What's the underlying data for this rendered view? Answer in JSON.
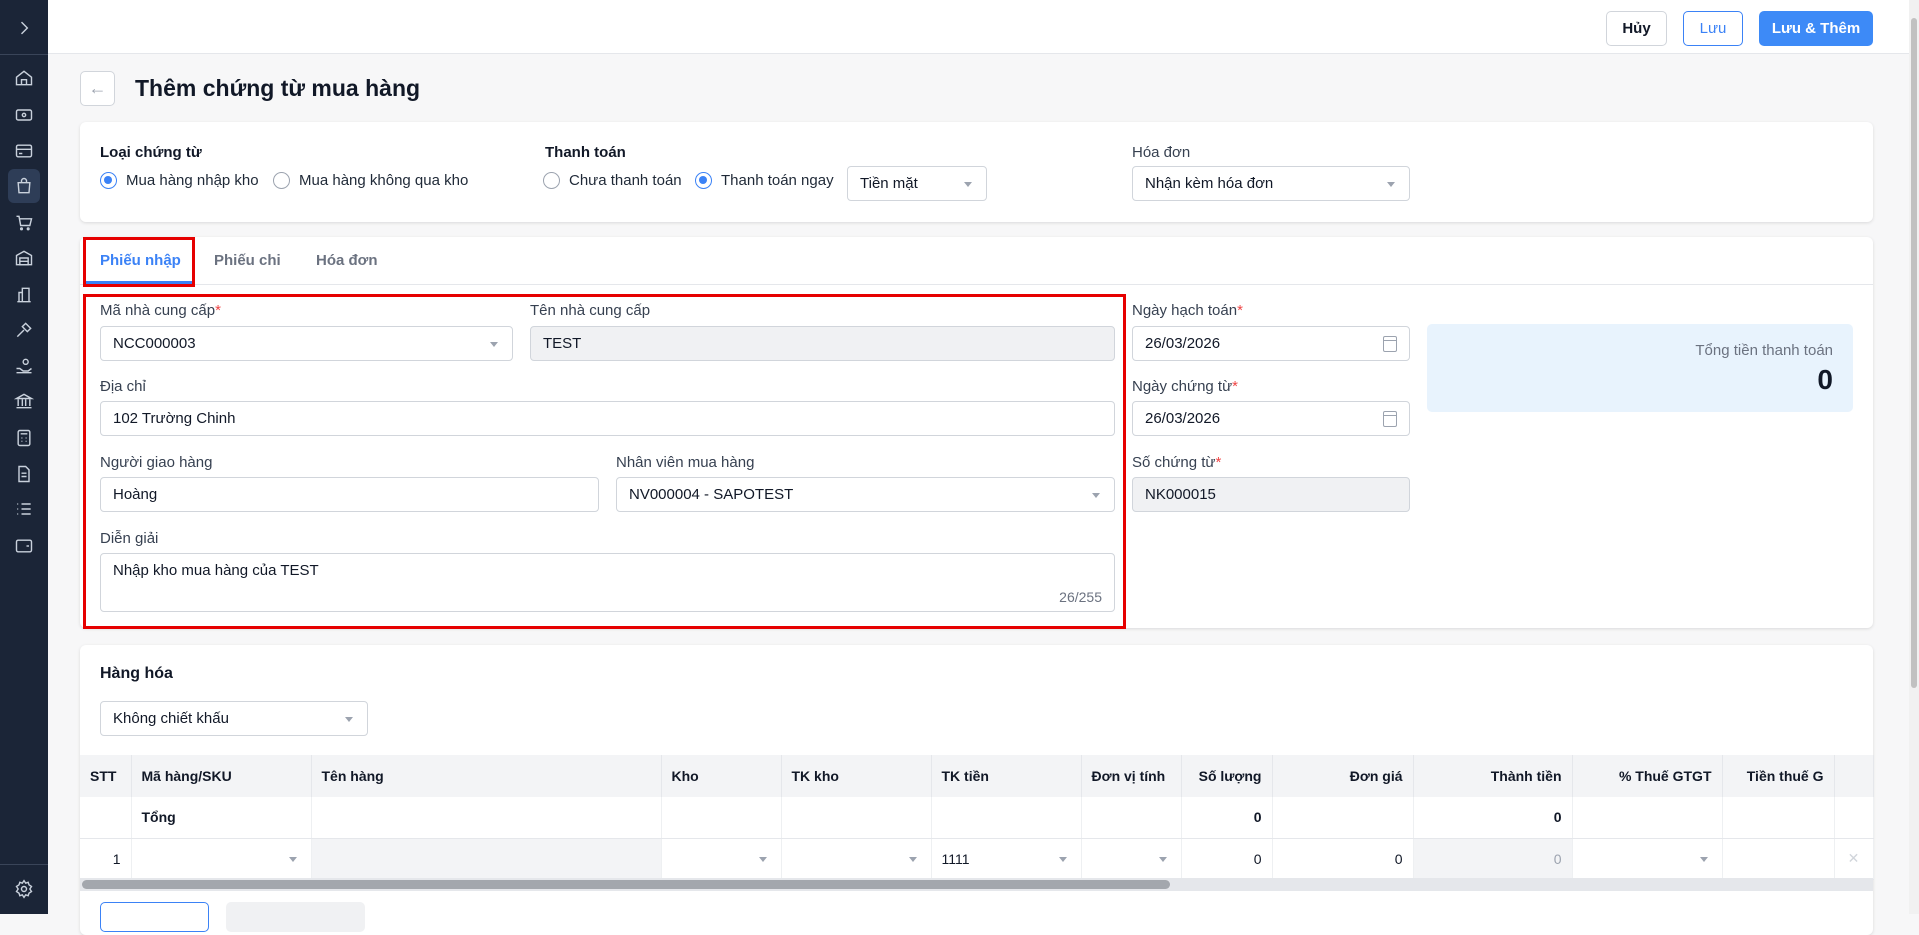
{
  "header": {
    "cancel": "Hủy",
    "save": "Lưu",
    "save_add": "Lưu & Thêm",
    "title": "Thêm chứng từ mua hàng"
  },
  "sidebar": {
    "icons": [
      "home-icon",
      "money-icon",
      "card-icon",
      "shopping-bag-icon",
      "cart-icon",
      "warehouse-icon",
      "building-icon",
      "tools-icon",
      "hand-coin-icon",
      "bank-icon",
      "calculator-icon",
      "document-icon",
      "list-icon",
      "wallet-icon"
    ],
    "settings": "gear-icon"
  },
  "voucher_type": {
    "label": "Loại chứng từ",
    "options": [
      "Mua hàng nhập kho",
      "Mua hàng không qua kho"
    ],
    "selected": 0
  },
  "payment": {
    "label": "Thanh toán",
    "options": [
      "Chưa thanh toán",
      "Thanh toán ngay"
    ],
    "selected": 1,
    "method": "Tiền mặt"
  },
  "invoice": {
    "label": "Hóa đơn",
    "value": "Nhận kèm hóa đơn"
  },
  "tabs": [
    "Phiếu nhập",
    "Phiếu chi",
    "Hóa đơn"
  ],
  "form": {
    "supplier_code_label": "Mã nhà cung cấp",
    "supplier_code": "NCC000003",
    "supplier_name_label": "Tên nhà cung cấp",
    "supplier_name": "TEST",
    "address_label": "Địa chỉ",
    "address": "102 Trường Chinh",
    "deliverer_label": "Người giao hàng",
    "deliverer": "Hoàng",
    "buyer_label": "Nhân viên mua hàng",
    "buyer": "NV000004 - SAPOTEST",
    "desc_label": "Diễn giải",
    "desc": "Nhập kho mua hàng của TEST",
    "desc_count": "26/255",
    "posting_date_label": "Ngày hạch toán",
    "posting_date": "26/03/2026",
    "doc_date_label": "Ngày chứng từ",
    "doc_date": "26/03/2026",
    "doc_no_label": "Số chứng từ",
    "doc_no": "NK000015",
    "required": "*"
  },
  "total": {
    "label": "Tổng tiền thanh toán",
    "value": "0"
  },
  "goods": {
    "title": "Hàng hóa",
    "discount": "Không chiết khấu",
    "columns": [
      "STT",
      "Mã hàng/SKU",
      "Tên hàng",
      "Kho",
      "TK kho",
      "TK tiền",
      "Đơn vị tính",
      "Số lượng",
      "Đơn giá",
      "Thành tiền",
      "% Thuế GTGT",
      "Tiền thuế G"
    ],
    "total_row": {
      "label": "Tổng",
      "qty": "0",
      "amount": "0"
    },
    "rows": [
      {
        "stt": "1",
        "tk_tien": "1111",
        "qty": "0",
        "price": "0",
        "amount": "0"
      }
    ]
  }
}
